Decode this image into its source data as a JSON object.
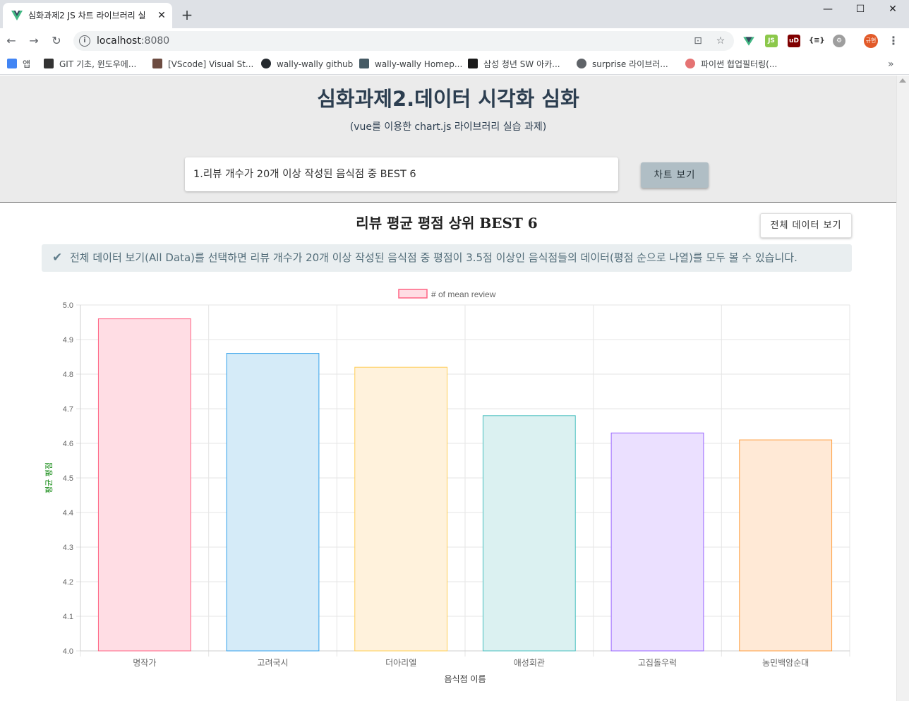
{
  "browser": {
    "tab_title": "심화과제2 JS 차트 라이브러리 실",
    "url_host": "localhost",
    "url_port": ":8080",
    "bookmarks": [
      {
        "label": "앱",
        "icon": "apps-grid-icon",
        "color": "#4285f4"
      },
      {
        "label": "GIT 기초, 윈도우에...",
        "icon": "git-icon",
        "color": "#333333"
      },
      {
        "label": "[VScode] Visual St...",
        "icon": "bear-icon",
        "color": "#6d4c41"
      },
      {
        "label": "wally-wally github",
        "icon": "github-icon",
        "color": "#24292e"
      },
      {
        "label": "wally-wally Homep...",
        "icon": "monitor-icon",
        "color": "#455a64"
      },
      {
        "label": "삼성 청년 SW 아카...",
        "icon": "ssafy-icon",
        "color": "#1a1a1a"
      },
      {
        "label": "surprise 라이브러...",
        "icon": "globe-icon",
        "color": "#5f6368"
      },
      {
        "label": "파이썬 협업필터링(...",
        "icon": "avatar-icon",
        "color": "#e57373"
      }
    ],
    "profile_initials": "규현"
  },
  "header": {
    "title": "심화과제2.데이터 시각화 심화",
    "subtitle": "(vue를 이용한 chart.js 라이브러리 실습 과제)"
  },
  "controls": {
    "selected_option": "1.리뷰 개수가 20개 이상 작성된 음식점 중 BEST 6",
    "chart_button": "차트 보기",
    "all_data_button": "전체 데이터 보기"
  },
  "section": {
    "title": "리뷰 평균 평점 상위 BEST 6",
    "notice": "전체 데이터 보기(All Data)를 선택하면 리뷰 개수가 20개 이상 작성된 음식점 중 평점이 3.5점 이상인 음식점들의 데이터(평점 순으로 나열)를 모두 볼 수 있습니다."
  },
  "chart_data": {
    "type": "bar",
    "categories": [
      "명작가",
      "고려국시",
      "더아리엘",
      "애성회관",
      "고집돌우럭",
      "농민백암순대"
    ],
    "series": [
      {
        "name": "# of mean review",
        "values": [
          4.96,
          4.86,
          4.82,
          4.68,
          4.63,
          4.61
        ]
      }
    ],
    "xlabel": "음식점 이름",
    "ylabel": "평균 평점",
    "ylim": [
      4.0,
      5.0
    ],
    "yticks": [
      "5.0",
      "4.9",
      "4.8",
      "4.7",
      "4.6",
      "4.5",
      "4.4",
      "4.3",
      "4.2",
      "4.1",
      "4.0"
    ],
    "grid": true,
    "legend_position": "top",
    "colors": {
      "fills": [
        "#ffdde4",
        "#d5ebf8",
        "#fff2dc",
        "#dbf1f1",
        "#ebe0ff",
        "#ffe9d6"
      ],
      "borders": [
        "#ff6384",
        "#36a2eb",
        "#ffce56",
        "#4bc0c0",
        "#9966ff",
        "#ff9f40"
      ],
      "ylabel_color": "#008000",
      "legend_fill": "#ffdde4",
      "legend_border": "#ff6384"
    }
  }
}
